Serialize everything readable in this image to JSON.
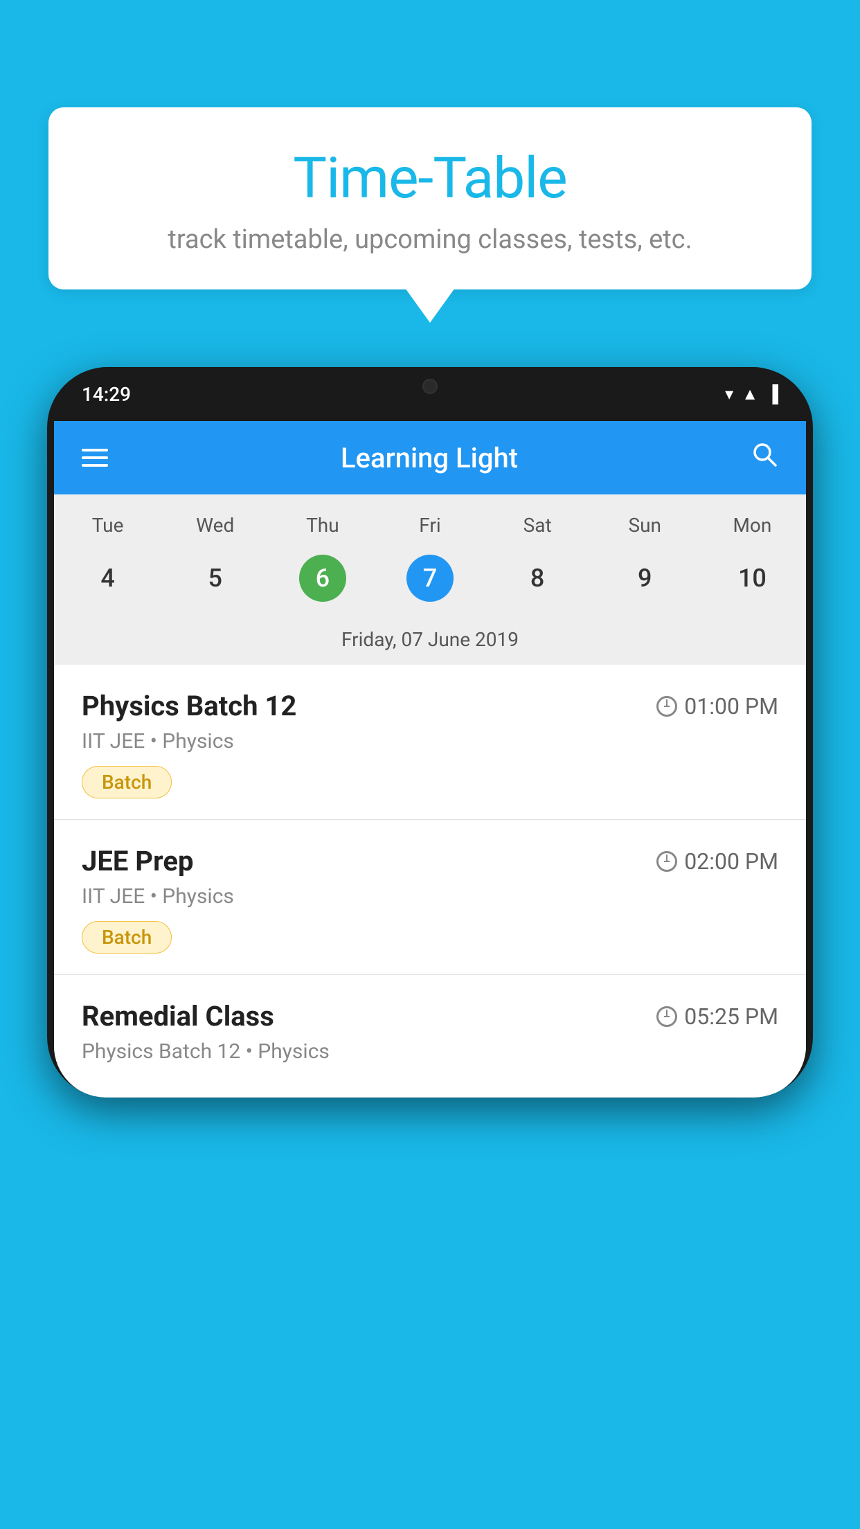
{
  "background_color": "#19b8e8",
  "speech_bubble": {
    "title": "Time-Table",
    "subtitle": "track timetable, upcoming classes, tests, etc."
  },
  "phone": {
    "status_bar": {
      "time": "14:29"
    },
    "app_bar": {
      "title": "Learning Light"
    },
    "calendar": {
      "days": [
        "Tue",
        "Wed",
        "Thu",
        "Fri",
        "Sat",
        "Sun",
        "Mon"
      ],
      "dates": [
        {
          "num": "4",
          "state": "normal"
        },
        {
          "num": "5",
          "state": "normal"
        },
        {
          "num": "6",
          "state": "today"
        },
        {
          "num": "7",
          "state": "selected"
        },
        {
          "num": "8",
          "state": "normal"
        },
        {
          "num": "9",
          "state": "normal"
        },
        {
          "num": "10",
          "state": "normal"
        }
      ],
      "selected_date_label": "Friday, 07 June 2019"
    },
    "schedule": [
      {
        "title": "Physics Batch 12",
        "time": "01:00 PM",
        "subtitle": "IIT JEE • Physics",
        "tag": "Batch"
      },
      {
        "title": "JEE Prep",
        "time": "02:00 PM",
        "subtitle": "IIT JEE • Physics",
        "tag": "Batch"
      },
      {
        "title": "Remedial Class",
        "time": "05:25 PM",
        "subtitle": "Physics Batch 12 • Physics",
        "tag": ""
      }
    ]
  }
}
